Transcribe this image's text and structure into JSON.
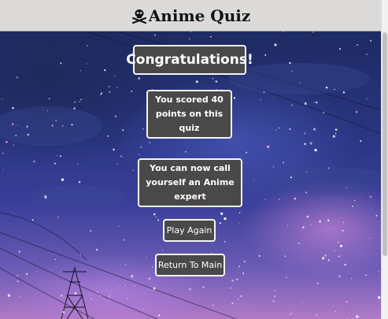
{
  "header": {
    "title": "Anime Quiz",
    "icon": "skull-crossbones-icon"
  },
  "result": {
    "congrats": "Congratulations!",
    "score_text": "You scored 40 points on this quiz",
    "expert_text": "You can now call yourself an Anime expert"
  },
  "actions": {
    "play_again": "Play Again",
    "return_main": "Return To Main"
  },
  "colors": {
    "header_bg": "#dcdad8",
    "card_bg": "#4a4949",
    "card_border": "#f4f4f4"
  }
}
